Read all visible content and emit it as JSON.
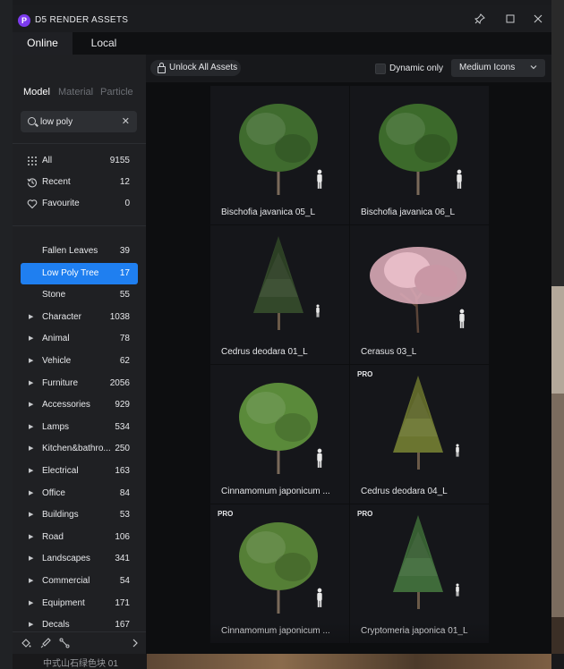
{
  "window": {
    "title": "D5 RENDER ASSETS",
    "logo_letter": "P"
  },
  "tabs": [
    {
      "label": "Online",
      "active": true
    },
    {
      "label": "Local",
      "active": false
    }
  ],
  "subtabs": [
    {
      "label": "Model",
      "active": true
    },
    {
      "label": "Material",
      "active": false
    },
    {
      "label": "Particle",
      "active": false
    }
  ],
  "search": {
    "value": "low poly",
    "clear_icon": "close-icon"
  },
  "quick_filters": [
    {
      "icon": "grid-icon",
      "label": "All",
      "count": "9155"
    },
    {
      "icon": "history-icon",
      "label": "Recent",
      "count": "12"
    },
    {
      "icon": "heart-icon",
      "label": "Favourite",
      "count": "0"
    }
  ],
  "categories": [
    {
      "label": "Fallen Leaves",
      "count": "39",
      "expandable": false,
      "selected": false
    },
    {
      "label": "Low Poly Tree",
      "count": "17",
      "expandable": false,
      "selected": true
    },
    {
      "label": "Stone",
      "count": "55",
      "expandable": false,
      "selected": false
    },
    {
      "label": "Character",
      "count": "1038",
      "expandable": true,
      "selected": false
    },
    {
      "label": "Animal",
      "count": "78",
      "expandable": true,
      "selected": false
    },
    {
      "label": "Vehicle",
      "count": "62",
      "expandable": true,
      "selected": false
    },
    {
      "label": "Furniture",
      "count": "2056",
      "expandable": true,
      "selected": false
    },
    {
      "label": "Accessories",
      "count": "929",
      "expandable": true,
      "selected": false
    },
    {
      "label": "Lamps",
      "count": "534",
      "expandable": true,
      "selected": false
    },
    {
      "label": "Kitchen&bathro...",
      "count": "250",
      "expandable": true,
      "selected": false
    },
    {
      "label": "Electrical",
      "count": "163",
      "expandable": true,
      "selected": false
    },
    {
      "label": "Office",
      "count": "84",
      "expandable": true,
      "selected": false
    },
    {
      "label": "Buildings",
      "count": "53",
      "expandable": true,
      "selected": false
    },
    {
      "label": "Road",
      "count": "106",
      "expandable": true,
      "selected": false
    },
    {
      "label": "Landscapes",
      "count": "341",
      "expandable": true,
      "selected": false
    },
    {
      "label": "Commercial",
      "count": "54",
      "expandable": true,
      "selected": false
    },
    {
      "label": "Equipment",
      "count": "171",
      "expandable": true,
      "selected": false
    },
    {
      "label": "Decals",
      "count": "167",
      "expandable": true,
      "selected": false
    }
  ],
  "toolbar": {
    "unlock_label": "Unlock All Assets",
    "dynamic_label": "Dynamic only",
    "dynamic_checked": false,
    "size_select": "Medium Icons"
  },
  "assets": [
    {
      "name": "Bischofia javanica 05_L",
      "pro": false,
      "kind": "broadleaf",
      "foliage": "#3f6b2e"
    },
    {
      "name": "Bischofia javanica 06_L",
      "pro": false,
      "kind": "broadleaf",
      "foliage": "#3c6a2b"
    },
    {
      "name": "Cedrus deodara 01_L",
      "pro": false,
      "kind": "conifer",
      "foliage": "#33482a"
    },
    {
      "name": "Cerasus 03_L",
      "pro": false,
      "kind": "blossom",
      "foliage": "#d8a9b6"
    },
    {
      "name": "Cinnamomum japonicum ...",
      "pro": false,
      "kind": "broadleaf",
      "foliage": "#5a8a3a"
    },
    {
      "name": "Cedrus deodara 04_L",
      "pro": true,
      "kind": "conifer",
      "foliage": "#6b7530"
    },
    {
      "name": "Cinnamomum japonicum ...",
      "pro": true,
      "kind": "broadleaf",
      "foliage": "#557f36"
    },
    {
      "name": "Cryptomeria japonica 01_L",
      "pro": true,
      "kind": "conifer",
      "foliage": "#3f6b3a"
    }
  ],
  "pro_badge": "PRO",
  "background": {
    "bottom_label": "中式山石绿色块 01"
  },
  "colors": {
    "accent": "#1f7ff0",
    "brand": "#7c3aed"
  }
}
